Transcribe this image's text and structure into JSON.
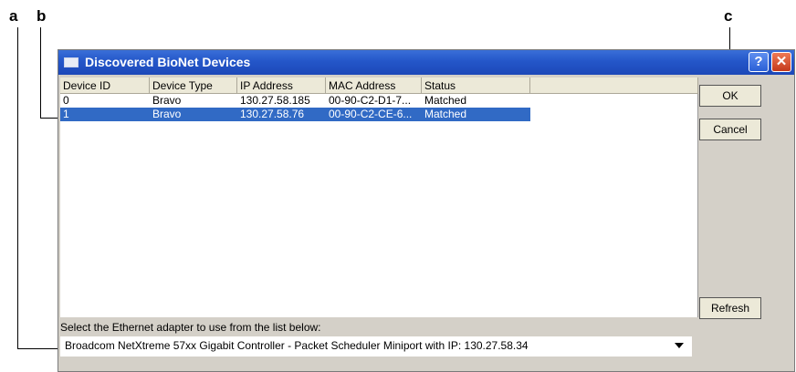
{
  "callouts": {
    "a": "a",
    "b": "b",
    "c": "c"
  },
  "window": {
    "title": "Discovered BioNet Devices",
    "help_label": "?",
    "close_label": "✕"
  },
  "columns": [
    "Device ID",
    "Device Type",
    "IP Address",
    "MAC Address",
    "Status"
  ],
  "rows": [
    {
      "id": "0",
      "type": "Bravo",
      "ip": "130.27.58.185",
      "mac": "00-90-C2-D1-7...",
      "status": "Matched",
      "selected": false
    },
    {
      "id": "1",
      "type": "Bravo",
      "ip": "130.27.58.76",
      "mac": "00-90-C2-CE-6...",
      "status": "Matched",
      "selected": true
    }
  ],
  "buttons": {
    "ok": "OK",
    "cancel": "Cancel",
    "refresh": "Refresh"
  },
  "adapter": {
    "label": "Select the Ethernet adapter to use from the list below:",
    "selected": "Broadcom NetXtreme 57xx Gigabit Controller - Packet Scheduler Miniport with IP: 130.27.58.34"
  },
  "colors": {
    "selection": "#316ac5",
    "titlebar": "#2456c9",
    "dialog_bg": "#d4d0c8"
  }
}
